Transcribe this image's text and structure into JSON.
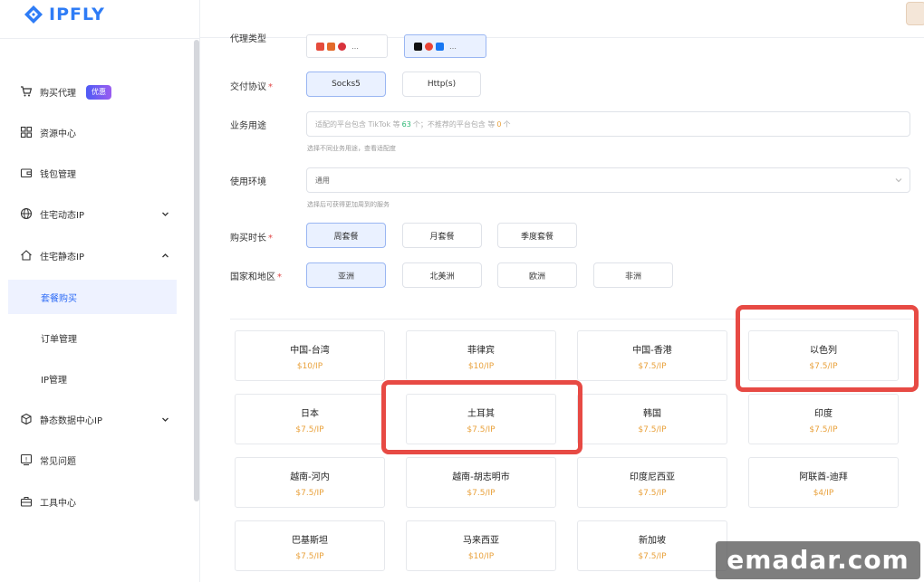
{
  "app": {
    "logo_text": "IPFLY",
    "brand_color": "#2e7cf6",
    "accent_color": "#e9a13b",
    "highlight_color": "#e74a44"
  },
  "sidebar": {
    "items": [
      {
        "label": "购买代理",
        "icon": "cart-icon",
        "badge": "优惠"
      },
      {
        "label": "资源中心",
        "icon": "grid-icon"
      },
      {
        "label": "钱包管理",
        "icon": "wallet-icon"
      },
      {
        "label": "住宅动态IP",
        "icon": "globe-icon",
        "chevron": "down"
      },
      {
        "label": "住宅静态IP",
        "icon": "home-icon",
        "chevron": "up"
      },
      {
        "label": "套餐购买",
        "sub": true,
        "active": true
      },
      {
        "label": "订单管理",
        "sub": true
      },
      {
        "label": "IP管理",
        "sub": true
      },
      {
        "label": "静态数据中心IP",
        "icon": "cube-icon",
        "chevron": "down"
      },
      {
        "label": "常见问题",
        "icon": "question-icon"
      },
      {
        "label": "工具中心",
        "icon": "toolbox-icon"
      }
    ]
  },
  "form": {
    "platform_label": "代理类型",
    "protocol": {
      "label": "交付协议",
      "options": [
        "Socks5",
        "Http(s)"
      ],
      "selected": 0
    },
    "usage": {
      "label": "业务用途",
      "placeholder_prefix": "适配的平台包含 TikTok 等",
      "count_supported": "63",
      "placeholder_mid": "个；不推荐的平台包含 等",
      "count_unsupported": "0",
      "placeholder_suffix": "个",
      "hint": "选择不同业务用途，查看适配度"
    },
    "environment": {
      "label": "使用环境",
      "value": "通用",
      "hint": "选择后可获得更加周到的服务"
    },
    "duration": {
      "label": "购买时长",
      "options": [
        "周套餐",
        "月套餐",
        "季度套餐"
      ],
      "selected": 0
    },
    "region": {
      "label": "国家和地区",
      "options": [
        "亚洲",
        "北美洲",
        "欧洲",
        "非洲"
      ],
      "selected": 0
    }
  },
  "countries": [
    {
      "name": "中国-台湾",
      "price": "$10/IP"
    },
    {
      "name": "菲律宾",
      "price": "$10/IP"
    },
    {
      "name": "中国-香港",
      "price": "$7.5/IP"
    },
    {
      "name": "以色列",
      "price": "$7.5/IP"
    },
    {
      "name": "日本",
      "price": "$7.5/IP"
    },
    {
      "name": "土耳其",
      "price": "$7.5/IP"
    },
    {
      "name": "韩国",
      "price": "$7.5/IP"
    },
    {
      "name": "印度",
      "price": "$7.5/IP"
    },
    {
      "name": "越南-河内",
      "price": "$7.5/IP"
    },
    {
      "name": "越南-胡志明市",
      "price": "$7.5/IP"
    },
    {
      "name": "印度尼西亚",
      "price": "$7.5/IP"
    },
    {
      "name": "阿联酋-迪拜",
      "price": "$4/IP"
    },
    {
      "name": "巴基斯坦",
      "price": "$7.5/IP"
    },
    {
      "name": "马来西亚",
      "price": "$10/IP"
    },
    {
      "name": "新加坡",
      "price": "$7.5/IP"
    }
  ],
  "highlighted_countries": [
    "以色列",
    "土耳其"
  ],
  "watermark": "emadar.com"
}
